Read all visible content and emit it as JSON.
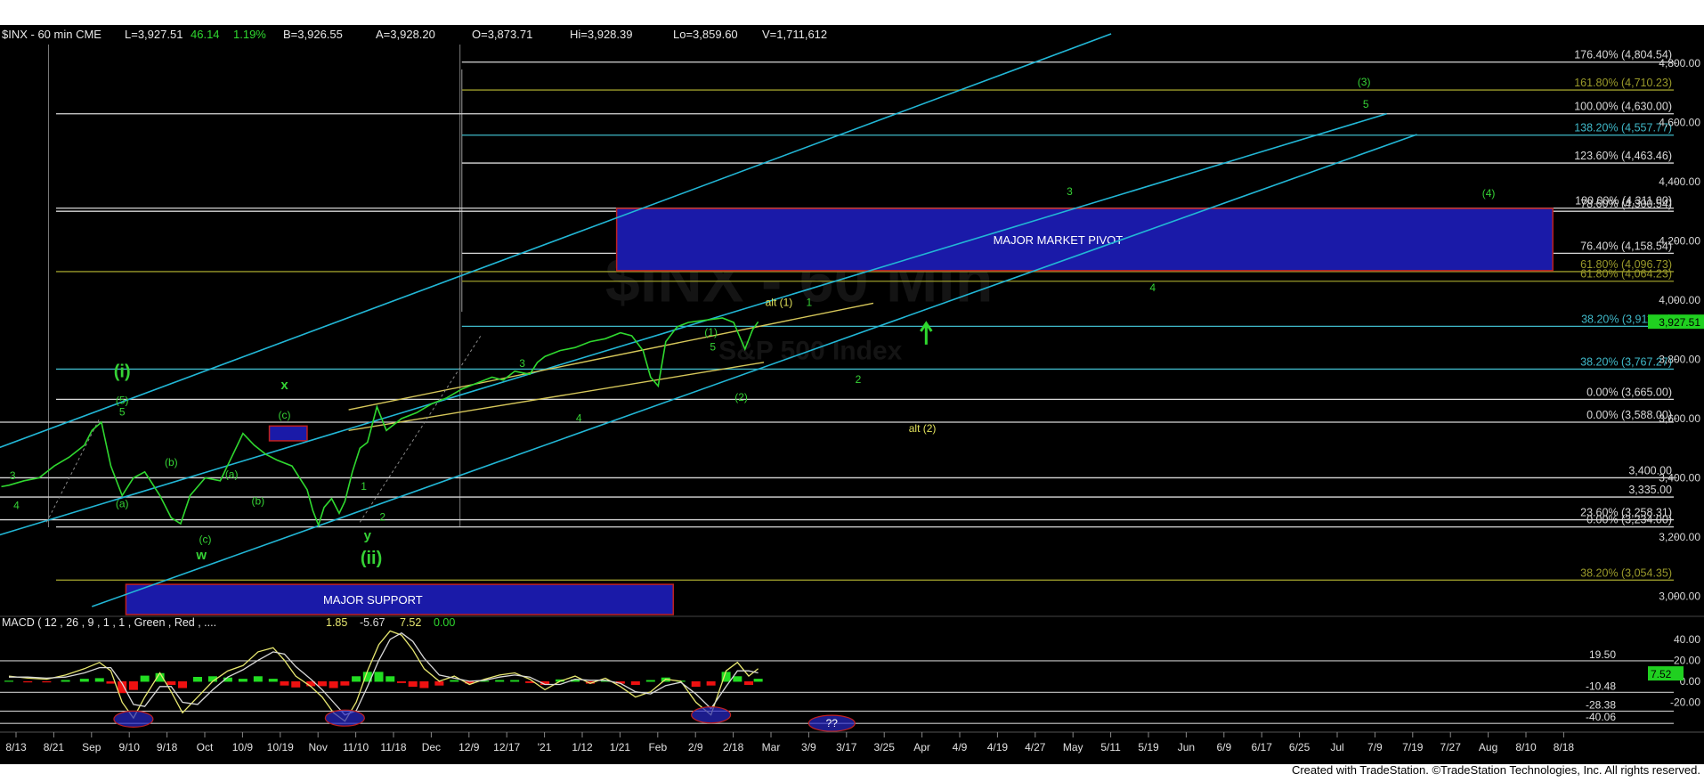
{
  "header": {
    "symbol": "$INX - 60 min  CME",
    "last": "L=3,927.51",
    "change": "46.14",
    "change_pct": "1.19%",
    "bid": "B=3,926.55",
    "ask": "A=3,928.20",
    "open": "O=3,873.71",
    "high": "Hi=3,928.39",
    "low": "Lo=3,859.60",
    "volume": "V=1,711,612"
  },
  "footer": {
    "credit": "Created with TradeStation. ©TradeStation Technologies, Inc. All rights reserved."
  },
  "colors": {
    "background": "#000000",
    "price": "#2fd82f",
    "channel": "#22b7d6",
    "wedge": "#d6c75a",
    "fib_cyan": "#3fb8c8",
    "fib_olive": "#9a9a2a",
    "fib_white": "#d8d8d8",
    "pivot_box": "#1a1aa8",
    "pivot_border": "#c02020",
    "wave_green": "#35d235",
    "wave_yellow": "#e0e05a",
    "macd_fast": "#e8e870",
    "macd_slow": "#d8d8d8",
    "hist_pos": "#22dd22",
    "hist_neg": "#ee1111",
    "last_price_bg": "#20d020"
  },
  "chart_data": [
    {
      "type": "line",
      "title": "$INX - 60 min",
      "ylim": [
        2950,
        4900
      ],
      "y_ticks": [
        "3,000.00",
        "3,200.00",
        "3,400.00",
        "3,600.00",
        "3,800.00",
        "4,000.00",
        "4,200.00",
        "4,400.00",
        "4,600.00",
        "4,800.00"
      ],
      "y_tick_values": [
        3000,
        3200,
        3400,
        3600,
        3800,
        4000,
        4200,
        4400,
        4600,
        4800
      ],
      "x_labels": [
        "8/13",
        "8/21",
        "Sep",
        "9/10",
        "9/18",
        "Oct",
        "10/9",
        "10/19",
        "Nov",
        "11/10",
        "11/18",
        "Dec",
        "12/9",
        "12/17",
        "'21",
        "1/12",
        "1/21",
        "Feb",
        "2/9",
        "2/18",
        "Mar",
        "3/9",
        "3/17",
        "3/25",
        "Apr",
        "4/9",
        "4/19",
        "4/27",
        "May",
        "5/11",
        "5/19",
        "Jun",
        "6/9",
        "6/17",
        "6/25",
        "Jul",
        "7/9",
        "7/19",
        "7/27",
        "Aug",
        "8/10",
        "8/18"
      ],
      "x_label_pos": [
        0,
        1,
        2,
        3,
        4,
        5,
        6,
        7,
        8,
        9,
        10,
        11,
        12,
        13,
        14,
        15,
        16,
        17,
        18,
        19,
        20,
        21,
        22,
        23,
        24,
        25,
        26,
        27,
        28,
        29,
        30,
        31,
        32,
        33,
        34,
        35,
        36,
        37,
        38,
        39,
        40,
        41
      ],
      "series": [
        {
          "values_x": [
            -0.2,
            0,
            0.4,
            0.8,
            1.2,
            1.6,
            2.0,
            2.2,
            2.45,
            2.7,
            3.0,
            3.3,
            3.6,
            4.0,
            4.3,
            4.55,
            4.8,
            5.2,
            5.6,
            5.9,
            6.2,
            6.5,
            6.8,
            7.1,
            7.5,
            7.9,
            8.05,
            8.2,
            8.35,
            8.55,
            8.75,
            8.9,
            9.1,
            9.3,
            9.5,
            9.75,
            10.0,
            10.4,
            10.8,
            11.2,
            11.6,
            12.0,
            12.4,
            12.8,
            13.1,
            13.4,
            13.8,
            14.0,
            14.2,
            14.6,
            15.0,
            15.4,
            15.8,
            16.2,
            16.5,
            16.8,
            17.0,
            17.2,
            17.4,
            17.7,
            18.0,
            18.3,
            18.6,
            18.9,
            19.2,
            19.35,
            19.5,
            19.7,
            19.85
          ],
          "values_y": [
            3370,
            3375,
            3390,
            3400,
            3440,
            3470,
            3510,
            3560,
            3588,
            3440,
            3340,
            3400,
            3420,
            3340,
            3265,
            3245,
            3340,
            3400,
            3390,
            3470,
            3550,
            3510,
            3480,
            3460,
            3440,
            3360,
            3290,
            3240,
            3300,
            3330,
            3280,
            3320,
            3420,
            3500,
            3520,
            3640,
            3560,
            3600,
            3620,
            3650,
            3670,
            3700,
            3720,
            3740,
            3730,
            3760,
            3750,
            3790,
            3810,
            3830,
            3840,
            3860,
            3870,
            3890,
            3880,
            3830,
            3740,
            3710,
            3860,
            3910,
            3925,
            3930,
            3935,
            3940,
            3925,
            3880,
            3835,
            3900,
            3927
          ]
        }
      ],
      "fib_levels": [
        {
          "label": "176.40% (4,804.54)",
          "value": 4804.54,
          "color": "fib_white"
        },
        {
          "label": "161.80% (4,710.23)",
          "value": 4710.23,
          "color": "fib_olive"
        },
        {
          "label": "100.00% (4,630.00)",
          "value": 4630.0,
          "color": "fib_white"
        },
        {
          "label": "138.20% (4,557.77)",
          "value": 4557.77,
          "color": "fib_cyan"
        },
        {
          "label": "123.60% (4,463.46)",
          "value": 4463.46,
          "color": "fib_white"
        },
        {
          "label": "100.00% (4,311.00)",
          "value": 4311.0,
          "color": "fib_white"
        },
        {
          "label": "78.60% (4,300.54)",
          "value": 4300.54,
          "color": "fib_white"
        },
        {
          "label": "76.40% (4,158.54)",
          "value": 4158.54,
          "color": "fib_white"
        },
        {
          "label": "61.80% (4,096.73)",
          "value": 4096.73,
          "color": "fib_olive"
        },
        {
          "label": "61.80% (4,064.23)",
          "value": 4064.23,
          "color": "fib_olive"
        },
        {
          "label": "38.20% (3,911.77)",
          "value": 3911.77,
          "color": "fib_cyan"
        },
        {
          "label": "38.20% (3,767.27)",
          "value": 3767.27,
          "color": "fib_cyan"
        },
        {
          "label": "0.00% (3,665.00)",
          "value": 3665.0,
          "color": "fib_white"
        },
        {
          "label": "0.00% (3,588.00)",
          "value": 3588.0,
          "color": "fib_white"
        },
        {
          "label": "3,400.00",
          "value": 3400.0,
          "color": "fib_white"
        },
        {
          "label": "3,335.00",
          "value": 3335.0,
          "color": "fib_white"
        },
        {
          "label": "23.60% (3,258.31)",
          "value": 3258.31,
          "color": "fib_white"
        },
        {
          "label": "0.00% (3,234.00)",
          "value": 3234.0,
          "color": "fib_white"
        },
        {
          "label": "38.20% (3,054.35)",
          "value": 3054.35,
          "color": "fib_olive"
        }
      ],
      "last_price": "3,927.51",
      "last_price_value": 3927.51,
      "zones": [
        {
          "label": "MAJOR MARKET PIVOT",
          "x": [
            16.1,
            40.9
          ],
          "y": [
            4100,
            4310
          ]
        },
        {
          "label": "MAJOR SUPPORT",
          "x": [
            3.1,
            17.6
          ],
          "y": [
            2950,
            3040
          ]
        },
        {
          "label": "",
          "x": [
            6.9,
            7.9
          ],
          "y": [
            3525,
            3575
          ]
        }
      ],
      "wave_labels": [
        {
          "text": "(i)",
          "x": 3.0,
          "y": 3740,
          "color": "wave_green",
          "size": 20
        },
        {
          "text": "(5)",
          "x": 3.0,
          "y": 3650,
          "color": "wave_green",
          "size": 12
        },
        {
          "text": "5",
          "x": 3.0,
          "y": 3610,
          "color": "wave_green",
          "size": 12
        },
        {
          "text": "3",
          "x": 0.1,
          "y": 3395,
          "color": "wave_green",
          "size": 12
        },
        {
          "text": "4",
          "x": 0.2,
          "y": 3295,
          "color": "wave_green",
          "size": 12
        },
        {
          "text": "(a)",
          "x": 3.0,
          "y": 3300,
          "color": "wave_green",
          "size": 12
        },
        {
          "text": "(b)",
          "x": 4.3,
          "y": 3440,
          "color": "wave_green",
          "size": 12
        },
        {
          "text": "(c)",
          "x": 5.2,
          "y": 3180,
          "color": "wave_green",
          "size": 12
        },
        {
          "text": "w",
          "x": 5.1,
          "y": 3125,
          "color": "wave_green",
          "size": 15
        },
        {
          "text": "(a)",
          "x": 5.9,
          "y": 3400,
          "color": "wave_green",
          "size": 12
        },
        {
          "text": "(b)",
          "x": 6.6,
          "y": 3310,
          "color": "wave_green",
          "size": 12
        },
        {
          "text": "(c)",
          "x": 7.3,
          "y": 3600,
          "color": "wave_green",
          "size": 12
        },
        {
          "text": "x",
          "x": 7.3,
          "y": 3700,
          "color": "wave_green",
          "size": 15
        },
        {
          "text": "1",
          "x": 9.4,
          "y": 3360,
          "color": "wave_green",
          "size": 12
        },
        {
          "text": "2",
          "x": 9.9,
          "y": 3255,
          "color": "wave_green",
          "size": 12
        },
        {
          "text": "y",
          "x": 9.5,
          "y": 3190,
          "color": "wave_green",
          "size": 15
        },
        {
          "text": "(ii)",
          "x": 9.6,
          "y": 3110,
          "color": "wave_green",
          "size": 20
        },
        {
          "text": "3",
          "x": 13.6,
          "y": 3775,
          "color": "wave_green",
          "size": 12
        },
        {
          "text": "4",
          "x": 15.1,
          "y": 3590,
          "color": "wave_green",
          "size": 12
        },
        {
          "text": "(1)",
          "x": 18.6,
          "y": 3880,
          "color": "wave_green",
          "size": 12
        },
        {
          "text": "5",
          "x": 18.65,
          "y": 3830,
          "color": "wave_green",
          "size": 12
        },
        {
          "text": "(2)",
          "x": 19.4,
          "y": 3660,
          "color": "wave_green",
          "size": 12
        },
        {
          "text": "alt (1)",
          "x": 20.4,
          "y": 3980,
          "color": "wave_yellow",
          "size": 12
        },
        {
          "text": "1",
          "x": 21.2,
          "y": 3980,
          "color": "wave_green",
          "size": 12
        },
        {
          "text": "2",
          "x": 22.5,
          "y": 3720,
          "color": "wave_green",
          "size": 12
        },
        {
          "text": "alt (2)",
          "x": 24.2,
          "y": 3555,
          "color": "wave_yellow",
          "size": 12
        },
        {
          "text": "3",
          "x": 28.1,
          "y": 4355,
          "color": "wave_green",
          "size": 12
        },
        {
          "text": "4",
          "x": 30.3,
          "y": 4030,
          "color": "wave_green",
          "size": 12
        },
        {
          "text": "(3)",
          "x": 35.9,
          "y": 4725,
          "color": "wave_green",
          "size": 12
        },
        {
          "text": "5",
          "x": 35.95,
          "y": 4650,
          "color": "wave_green",
          "size": 12
        },
        {
          "text": "(4)",
          "x": 39.2,
          "y": 4350,
          "color": "wave_green",
          "size": 12
        }
      ],
      "watermark": [
        "$INX - 60 Min",
        "S&P 500 Index"
      ]
    },
    {
      "type": "line",
      "title": "MACD ( 12 , 26 , 9 , 1 , 1 , Green , Red , ....",
      "readouts": [
        "1.85",
        "-5.67",
        "7.52",
        "0.00"
      ],
      "ylim": [
        -45,
        50
      ],
      "y_ticks": [
        "40.00",
        "20.00",
        "0.00",
        "-20.00"
      ],
      "y_tick_values": [
        40,
        20,
        0,
        -20
      ],
      "levels": [
        {
          "label": "19.50",
          "value": 19.5
        },
        {
          "label": "-10.48",
          "value": -10.48
        },
        {
          "label": "-28.38",
          "value": -28.38
        },
        {
          "label": "-40.06",
          "value": -40.06
        }
      ],
      "last_value": "7.52",
      "last_value_num": 7.52,
      "callout": "??",
      "series": [
        {
          "name": "MACD",
          "values_x": [
            0,
            0.5,
            1.0,
            1.5,
            2.0,
            2.4,
            2.7,
            3.0,
            3.3,
            3.6,
            4.0,
            4.3,
            4.6,
            5.0,
            5.4,
            5.8,
            6.2,
            6.6,
            7.0,
            7.3,
            7.6,
            8.0,
            8.3,
            8.6,
            8.9,
            9.2,
            9.5,
            9.8,
            10.1,
            10.4,
            10.7,
            11.0,
            11.4,
            11.8,
            12.2,
            12.6,
            13.0,
            13.4,
            13.8,
            14.2,
            14.6,
            15.0,
            15.4,
            15.8,
            16.2,
            16.6,
            17.0,
            17.4,
            17.8,
            18.2,
            18.6,
            19.0,
            19.3,
            19.6,
            19.85
          ],
          "values_y": [
            5,
            3,
            2,
            6,
            12,
            18,
            10,
            -20,
            -35,
            -15,
            8,
            -10,
            -30,
            -15,
            0,
            10,
            15,
            28,
            32,
            20,
            5,
            -5,
            -15,
            -30,
            -38,
            -20,
            10,
            35,
            48,
            44,
            30,
            12,
            0,
            5,
            -3,
            2,
            6,
            8,
            2,
            -8,
            0,
            5,
            -2,
            3,
            -5,
            -15,
            -10,
            2,
            0,
            -20,
            -32,
            10,
            18,
            5,
            12
          ]
        },
        {
          "name": "Signal",
          "values_x": [
            0,
            0.5,
            1.0,
            1.5,
            2.0,
            2.4,
            2.7,
            3.0,
            3.3,
            3.6,
            4.0,
            4.3,
            4.6,
            5.0,
            5.4,
            5.8,
            6.2,
            6.6,
            7.0,
            7.3,
            7.6,
            8.0,
            8.3,
            8.6,
            8.9,
            9.2,
            9.5,
            9.8,
            10.1,
            10.4,
            10.7,
            11.0,
            11.4,
            11.8,
            12.2,
            12.6,
            13.0,
            13.4,
            13.8,
            14.2,
            14.6,
            15.0,
            15.4,
            15.8,
            16.2,
            16.6,
            17.0,
            17.4,
            17.8,
            18.2,
            18.6,
            19.0,
            19.3,
            19.6,
            19.85
          ],
          "values_y": [
            4,
            4,
            3,
            4,
            8,
            13,
            13,
            -2,
            -22,
            -24,
            -5,
            -5,
            -20,
            -22,
            -8,
            4,
            11,
            20,
            28,
            26,
            14,
            2,
            -8,
            -20,
            -32,
            -28,
            -5,
            20,
            40,
            46,
            38,
            22,
            6,
            3,
            0,
            1,
            4,
            6,
            4,
            -3,
            -3,
            2,
            1,
            1,
            -2,
            -10,
            -12,
            -4,
            -1,
            -12,
            -26,
            -5,
            10,
            10,
            8
          ]
        }
      ]
    }
  ]
}
